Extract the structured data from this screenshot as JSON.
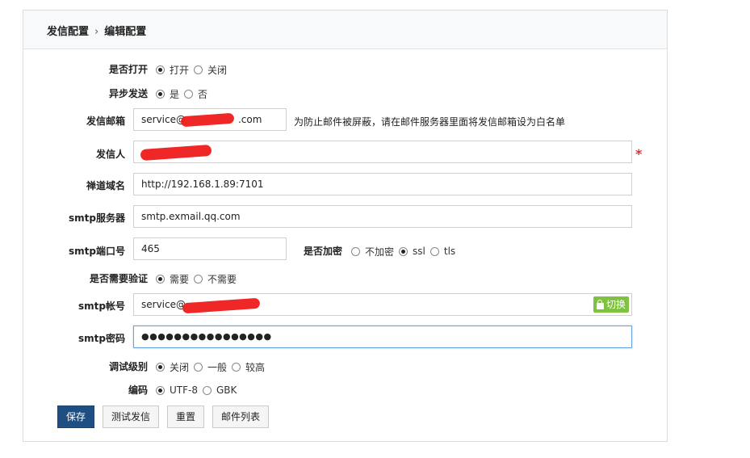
{
  "breadcrumb": {
    "parent": "发信配置",
    "separator": "›",
    "current": "编辑配置"
  },
  "form": {
    "enabled": {
      "label": "是否打开",
      "options": [
        "打开",
        "关闭"
      ],
      "selected": 0
    },
    "async": {
      "label": "异步发送",
      "options": [
        "是",
        "否"
      ],
      "selected": 0
    },
    "sender_email": {
      "label": "发信邮箱",
      "value_prefix": "service@",
      "value_suffix": ".com",
      "hint": "为防止邮件被屏蔽，请在邮件服务器里面将发信邮箱设为白名单"
    },
    "sender_name": {
      "label": "发信人",
      "required_mark": "*"
    },
    "domain": {
      "label": "禅道域名",
      "value": "http://192.168.1.89:7101"
    },
    "smtp_server": {
      "label": "smtp服务器",
      "value": "smtp.exmail.qq.com"
    },
    "smtp_port": {
      "label": "smtp端口号",
      "value": "465"
    },
    "encryption": {
      "label": "是否加密",
      "options": [
        "不加密",
        "ssl",
        "tls"
      ],
      "selected": 1
    },
    "need_auth": {
      "label": "是否需要验证",
      "options": [
        "需要",
        "不需要"
      ],
      "selected": 0
    },
    "smtp_account": {
      "label": "smtp帐号",
      "value_prefix": "service@",
      "switch_label": "切换"
    },
    "smtp_password": {
      "label": "smtp密码",
      "value": "●●●●●●●●●●●●●●●●"
    },
    "debug_level": {
      "label": "调试级别",
      "options": [
        "关闭",
        "一般",
        "较高"
      ],
      "selected": 0
    },
    "charset": {
      "label": "编码",
      "options": [
        "UTF-8",
        "GBK"
      ],
      "selected": 0
    }
  },
  "buttons": {
    "save": "保存",
    "test": "测试发信",
    "reset": "重置",
    "mail_list": "邮件列表"
  },
  "colors": {
    "primary": "#1f4e82",
    "switch_green": "#7fc241",
    "required_red": "#e03131"
  }
}
